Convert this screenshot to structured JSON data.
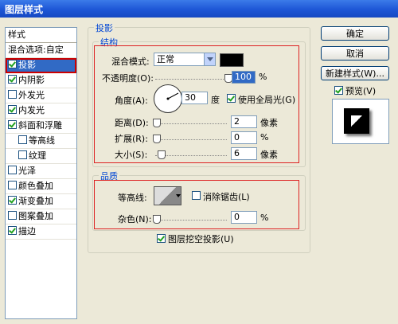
{
  "window": {
    "title": "图层样式"
  },
  "styles_panel": {
    "header": "样式",
    "items": [
      {
        "label": "混合选项:自定",
        "checkbox": false,
        "checked": false,
        "indent": false,
        "selected": false
      },
      {
        "label": "投影",
        "checkbox": true,
        "checked": true,
        "indent": false,
        "selected": true
      },
      {
        "label": "内阴影",
        "checkbox": true,
        "checked": true,
        "indent": false,
        "selected": false
      },
      {
        "label": "外发光",
        "checkbox": true,
        "checked": false,
        "indent": false,
        "selected": false
      },
      {
        "label": "内发光",
        "checkbox": true,
        "checked": true,
        "indent": false,
        "selected": false
      },
      {
        "label": "斜面和浮雕",
        "checkbox": true,
        "checked": true,
        "indent": false,
        "selected": false
      },
      {
        "label": "等高线",
        "checkbox": true,
        "checked": false,
        "indent": true,
        "selected": false
      },
      {
        "label": "纹理",
        "checkbox": true,
        "checked": false,
        "indent": true,
        "selected": false
      },
      {
        "label": "光泽",
        "checkbox": true,
        "checked": false,
        "indent": false,
        "selected": false
      },
      {
        "label": "颜色叠加",
        "checkbox": true,
        "checked": false,
        "indent": false,
        "selected": false
      },
      {
        "label": "渐变叠加",
        "checkbox": true,
        "checked": true,
        "indent": false,
        "selected": false
      },
      {
        "label": "图案叠加",
        "checkbox": true,
        "checked": false,
        "indent": false,
        "selected": false
      },
      {
        "label": "描边",
        "checkbox": true,
        "checked": true,
        "indent": false,
        "selected": false
      }
    ]
  },
  "shadow": {
    "title": "投影",
    "structure": {
      "title": "结构",
      "blend_mode_label": "混合模式:",
      "blend_mode_value": "正常",
      "opacity_label": "不透明度(O):",
      "opacity_value": "100",
      "opacity_unit": "%",
      "angle_label": "角度(A):",
      "angle_value": "30",
      "angle_unit": "度",
      "global_light_label": "使用全局光(G)",
      "global_light_checked": true,
      "distance_label": "距离(D):",
      "distance_value": "2",
      "distance_unit": "像素",
      "spread_label": "扩展(R):",
      "spread_value": "0",
      "spread_unit": "%",
      "size_label": "大小(S):",
      "size_value": "6",
      "size_unit": "像素"
    },
    "quality": {
      "title": "品质",
      "contour_label": "等高线:",
      "anti_alias_label": "消除锯齿(L)",
      "anti_alias_checked": false,
      "noise_label": "杂色(N):",
      "noise_value": "0",
      "noise_unit": "%"
    },
    "knockout_label": "图层挖空投影(U)",
    "knockout_checked": true
  },
  "buttons": {
    "ok": "确定",
    "cancel": "取消",
    "new_style": "新建样式(W)...",
    "preview_label": "预览(V)",
    "preview_checked": true
  },
  "colors": {
    "shadow_color": "#000000",
    "accent": "#0046d5",
    "highlight": "#316ac5",
    "title_bar": "#1d56d6"
  },
  "icons": {
    "blend_dropdown": "chevron-down-icon",
    "contour_dropdown": "chevron-down-icon"
  }
}
